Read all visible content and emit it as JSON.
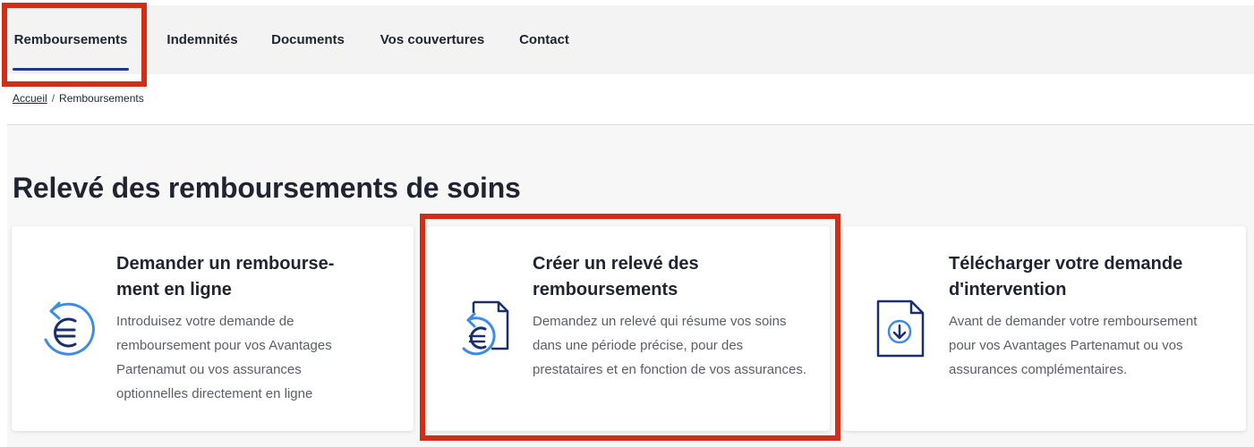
{
  "nav": {
    "tabs": [
      {
        "label": "Remboursements",
        "active": true
      },
      {
        "label": "Indemnités"
      },
      {
        "label": "Documents"
      },
      {
        "label": "Vos couvertures"
      },
      {
        "label": "Contact"
      }
    ]
  },
  "breadcrumb": {
    "home": "Accueil",
    "separator": "/",
    "current": "Remboursements"
  },
  "page": {
    "title": "Relevé des remboursements de soins"
  },
  "cards": [
    {
      "icon": "euro-refresh-icon",
      "title": "Demander un rembourse-ment en ligne",
      "description": "Introduisez votre demande de remboursement pour vos Avantages Partenamut ou vos assurances optionnelles directement en ligne"
    },
    {
      "icon": "document-euro-icon",
      "title": "Créer un relevé des remboursements",
      "description": "Demandez un relevé qui résume vos soins dans une période précise, pour des prestataires et en fonction de vos assurances."
    },
    {
      "icon": "document-download-icon",
      "title": "Télécharger votre demande d'intervention",
      "description": "Avant de demander votre remboursement pour vos Avantages Partenamut ou vos assurances complémentaires."
    }
  ],
  "colors": {
    "accent": "#1d3a8a",
    "icon_light": "#3d8ce3",
    "icon_dark": "#1a2f6b",
    "highlight": "#d22d17",
    "nav_bg": "#f3f3f3"
  }
}
